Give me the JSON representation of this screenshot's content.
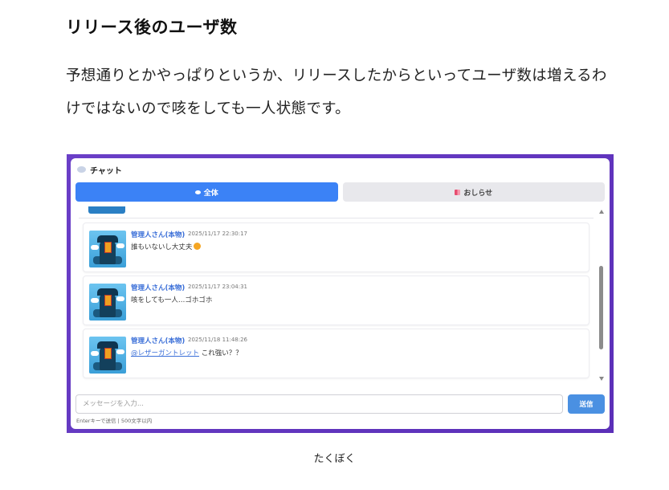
{
  "article": {
    "heading": "リリース後のユーザ数",
    "paragraph": "予想通りとかやっぱりというか、リリースしたからといってユーザ数は増えるわけではないので咳をしても一人状態です。",
    "caption": "たくぼく"
  },
  "chat": {
    "title": "チャット",
    "tabs": [
      {
        "label": "全体",
        "active": true
      },
      {
        "label": "おしらせ",
        "active": false
      }
    ],
    "messages": [
      {
        "name": "管理人さん(本物)",
        "time": "2025/11/17 22:30:17",
        "text": "誰もいないし大丈夫",
        "emoji": "smiling-face-icon"
      },
      {
        "name": "管理人さん(本物)",
        "time": "2025/11/17 23:04:31",
        "text": "咳をしても一人…ゴホゴホ"
      },
      {
        "name": "管理人さん(本物)",
        "time": "2025/11/18 11:48:26",
        "mention": "@レザーガントレット",
        "text": " これ強い？？"
      }
    ],
    "input": {
      "placeholder": "メッセージを入力...",
      "value": ""
    },
    "send_label": "送信",
    "hint": "Enterキーで送信 | 500文字以内"
  },
  "colors": {
    "frame": "#5b2fb8",
    "tab_active": "#3b82f6",
    "send_button": "#4a90e2",
    "username": "#3b6fd8"
  }
}
